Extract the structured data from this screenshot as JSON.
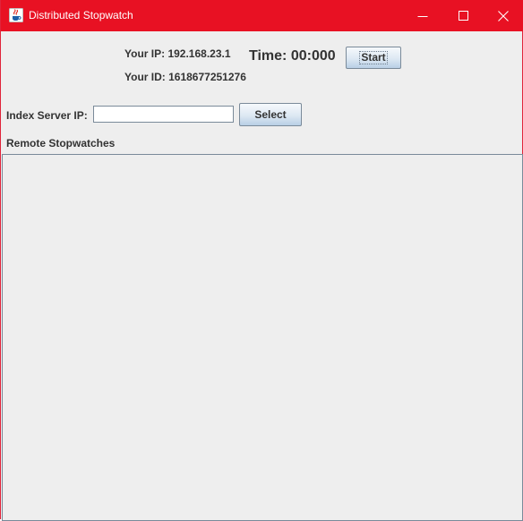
{
  "window": {
    "title": "Distributed Stopwatch",
    "icon": "java-cup-icon",
    "controls": [
      "minimize-icon",
      "maximize-icon",
      "close-icon"
    ],
    "titlebar_color": "#e81123"
  },
  "info": {
    "your_ip": "Your IP: 192.168.23.1",
    "your_id": "Your ID: 1618677251276",
    "time": "Time: 00:000",
    "start_label": "Start"
  },
  "index_server": {
    "label": "Index Server IP:",
    "value": "",
    "select_label": "Select"
  },
  "remote": {
    "heading": "Remote Stopwatches"
  }
}
